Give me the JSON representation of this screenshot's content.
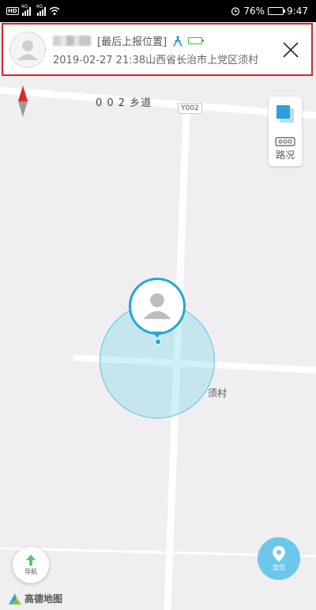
{
  "status_bar": {
    "hd": "HD",
    "net1": "4G",
    "net2": "4G",
    "battery_percent": "76%",
    "time": "9:47",
    "battery_level": 0.76
  },
  "info_card": {
    "last_report_label": "[最后上报位置]",
    "timestamp_location": "2019-02-27 21:38山西省长治市上党区须村",
    "device_battery_level": 0.75,
    "walk_icon": "walking-person-icon",
    "close_icon": "close-icon"
  },
  "map": {
    "road_name": "0 0 2 乡道",
    "road_badge": "Y002",
    "village_name": "须村",
    "traffic_label": "路况",
    "nav_label": "导航",
    "locate_label": "定位",
    "logo_text": "高德地图",
    "colors": {
      "accent": "#22a8d6",
      "circle": "#78d6eb",
      "locate": "#6cc8ea",
      "highlight_border": "#d3262d"
    }
  }
}
